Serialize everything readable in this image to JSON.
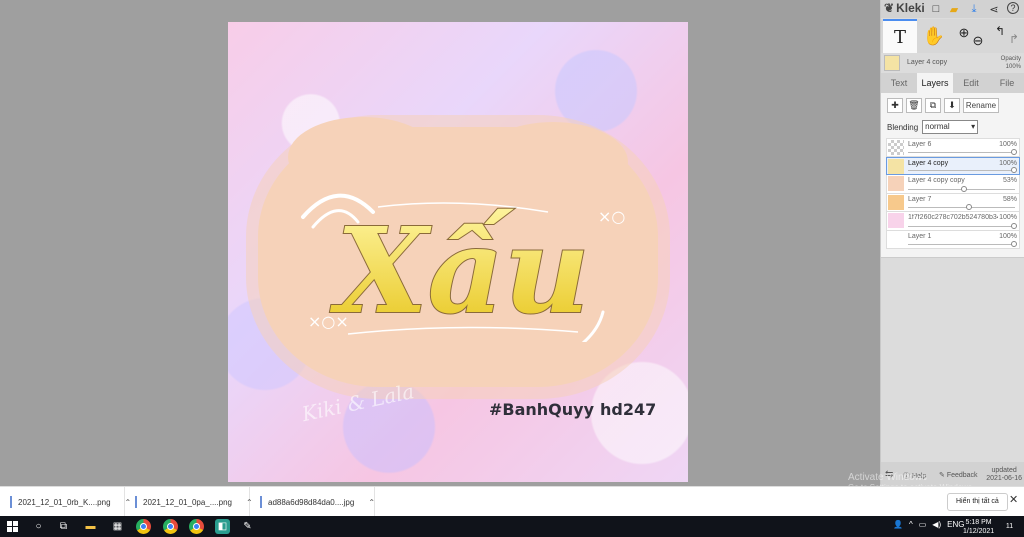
{
  "app": {
    "name": "Kleki"
  },
  "artwork": {
    "word": "Xấu",
    "hashtag": "#BanhQuyy",
    "handle": "hd247",
    "signature": "Kiki & Lala"
  },
  "panel": {
    "current_layer": {
      "name": "Layer 4 copy",
      "opacity_label": "Opacity",
      "opacity_value": "100%"
    },
    "tabs": [
      "Text",
      "Layers",
      "Edit",
      "File"
    ],
    "active_tab": "Layers",
    "rename_label": "Rename",
    "blending_label": "Blending",
    "blending_value": "normal",
    "layers": [
      {
        "name": "Layer 6",
        "opacity": "100%",
        "level": 1.0,
        "selected": false
      },
      {
        "name": "Layer 4 copy",
        "opacity": "100%",
        "level": 1.0,
        "selected": true
      },
      {
        "name": "Layer 4 copy copy",
        "opacity": "53%",
        "level": 0.53,
        "selected": false
      },
      {
        "name": "Layer 7",
        "opacity": "58%",
        "level": 0.58,
        "selected": false
      },
      {
        "name": "1f7f260c278c702b524780b34",
        "opacity": "100%",
        "level": 1.0,
        "selected": false
      },
      {
        "name": "Layer 1",
        "opacity": "100%",
        "level": 1.0,
        "selected": false
      }
    ],
    "footer": {
      "help": "Help",
      "feedback": "Feedback",
      "updated_label": "updated",
      "updated_date": "2021-06-16"
    }
  },
  "watermark": {
    "line1": "Activate Windows",
    "line2": "Go to Settings to activate Windows."
  },
  "downloads": {
    "items": [
      {
        "name": "2021_12_01_0rb_K....png"
      },
      {
        "name": "2021_12_01_0pa_....png"
      },
      {
        "name": "ad88a6d98d84da0....jpg"
      }
    ],
    "show_all": "Hiển thị tất cả"
  },
  "taskbar": {
    "language": "ENG",
    "time": "5:18 PM",
    "date": "1/12/2021",
    "notifications": "11"
  }
}
